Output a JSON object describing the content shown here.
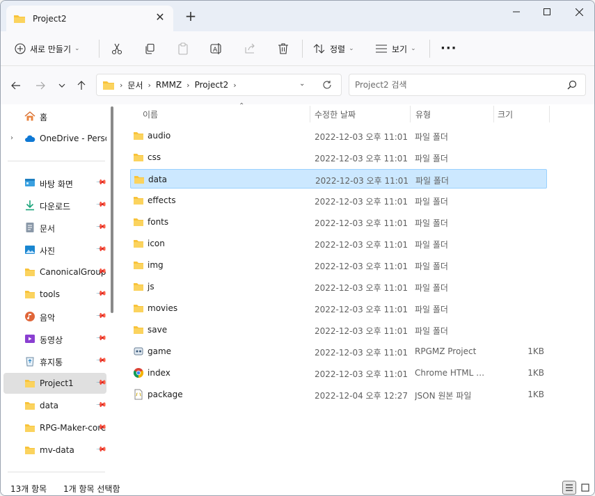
{
  "window": {
    "tab_title": "Project2",
    "new_tab": "+",
    "close_tab": "✕"
  },
  "toolbar": {
    "new_label": "새로 만들기",
    "sort_label": "정렬",
    "view_label": "보기",
    "more_label": "···"
  },
  "address": {
    "crumbs": [
      "문서",
      "RMMZ",
      "Project2"
    ],
    "search_placeholder": "Project2 검색"
  },
  "sidebar": {
    "home": "홈",
    "onedrive": "OneDrive - Personal",
    "quick": [
      {
        "label": "바탕 화면",
        "icon": "desktop-icon"
      },
      {
        "label": "다운로드",
        "icon": "download-icon"
      },
      {
        "label": "문서",
        "icon": "documents-icon"
      },
      {
        "label": "사진",
        "icon": "pictures-icon"
      },
      {
        "label": "CanonicalGroup",
        "icon": "folder-icon"
      },
      {
        "label": "tools",
        "icon": "folder-icon"
      },
      {
        "label": "음악",
        "icon": "music-icon"
      },
      {
        "label": "동영상",
        "icon": "videos-icon"
      },
      {
        "label": "휴지통",
        "icon": "recycle-bin-icon"
      },
      {
        "label": "Project1",
        "icon": "folder-icon"
      },
      {
        "label": "data",
        "icon": "folder-icon"
      },
      {
        "label": "RPG-Maker-core",
        "icon": "folder-icon"
      },
      {
        "label": "mv-data",
        "icon": "folder-icon"
      }
    ]
  },
  "columns": {
    "name": "이름",
    "date": "수정한 날짜",
    "type": "유형",
    "size": "크기"
  },
  "files": [
    {
      "name": "audio",
      "date": "2022-12-03 오후 11:01",
      "type": "파일 폴더",
      "size": "",
      "icon": "folder-icon"
    },
    {
      "name": "css",
      "date": "2022-12-03 오후 11:01",
      "type": "파일 폴더",
      "size": "",
      "icon": "folder-icon"
    },
    {
      "name": "data",
      "date": "2022-12-03 오후 11:01",
      "type": "파일 폴더",
      "size": "",
      "icon": "folder-icon"
    },
    {
      "name": "effects",
      "date": "2022-12-03 오후 11:01",
      "type": "파일 폴더",
      "size": "",
      "icon": "folder-icon"
    },
    {
      "name": "fonts",
      "date": "2022-12-03 오후 11:01",
      "type": "파일 폴더",
      "size": "",
      "icon": "folder-icon"
    },
    {
      "name": "icon",
      "date": "2022-12-03 오후 11:01",
      "type": "파일 폴더",
      "size": "",
      "icon": "folder-icon"
    },
    {
      "name": "img",
      "date": "2022-12-03 오후 11:01",
      "type": "파일 폴더",
      "size": "",
      "icon": "folder-icon"
    },
    {
      "name": "js",
      "date": "2022-12-03 오후 11:01",
      "type": "파일 폴더",
      "size": "",
      "icon": "folder-icon"
    },
    {
      "name": "movies",
      "date": "2022-12-03 오후 11:01",
      "type": "파일 폴더",
      "size": "",
      "icon": "folder-icon"
    },
    {
      "name": "save",
      "date": "2022-12-03 오후 11:01",
      "type": "파일 폴더",
      "size": "",
      "icon": "folder-icon"
    },
    {
      "name": "game",
      "date": "2022-12-03 오후 11:01",
      "type": "RPGMZ Project",
      "size": "1KB",
      "icon": "rpgmz-project-icon"
    },
    {
      "name": "index",
      "date": "2022-12-03 오후 11:01",
      "type": "Chrome HTML Document",
      "size": "1KB",
      "icon": "chrome-icon"
    },
    {
      "name": "package",
      "date": "2022-12-04 오후 12:27",
      "type": "JSON 원본 파일",
      "size": "1KB",
      "icon": "json-file-icon"
    }
  ],
  "status": {
    "count": "13개 항목",
    "selection": "1개 항목 선택함"
  },
  "colors": {
    "accent_folder": "#f8c33a",
    "selection_bg": "#cce8ff",
    "selection_border": "#99d1ff"
  }
}
